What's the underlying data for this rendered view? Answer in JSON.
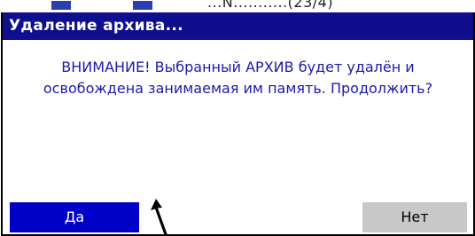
{
  "background": {
    "partial_text": "...N...........(23/4)"
  },
  "dialog": {
    "title": "Удаление архива...",
    "message_line1": "ВНИМАНИЕ! Выбранный АРХИВ будет удалён и",
    "message_line2": "освобождена занимаемая им память. Продолжить?",
    "yes_label": "Да",
    "no_label": "Нет"
  },
  "colors": {
    "titlebar": "#0e0e8f",
    "message_text": "#1a1ab0",
    "yes_button": "#0000c8",
    "no_button": "#c8c8c8"
  },
  "icons": {
    "cursor": "arrow-cursor-icon"
  }
}
